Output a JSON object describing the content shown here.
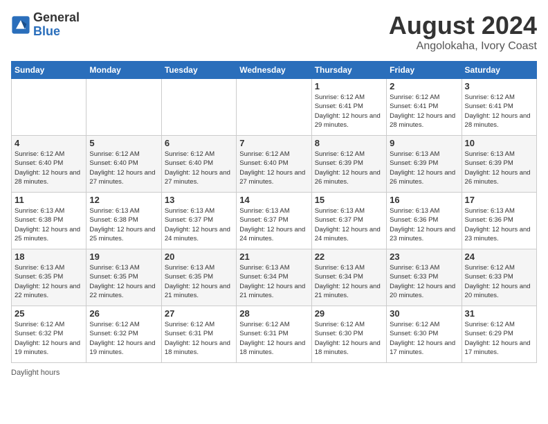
{
  "header": {
    "logo_general": "General",
    "logo_blue": "Blue",
    "month_year": "August 2024",
    "location": "Angolokaha, Ivory Coast"
  },
  "days_of_week": [
    "Sunday",
    "Monday",
    "Tuesday",
    "Wednesday",
    "Thursday",
    "Friday",
    "Saturday"
  ],
  "weeks": [
    [
      {
        "day": "",
        "info": ""
      },
      {
        "day": "",
        "info": ""
      },
      {
        "day": "",
        "info": ""
      },
      {
        "day": "",
        "info": ""
      },
      {
        "day": "1",
        "sunrise": "6:12 AM",
        "sunset": "6:41 PM",
        "daylight": "12 hours and 29 minutes."
      },
      {
        "day": "2",
        "sunrise": "6:12 AM",
        "sunset": "6:41 PM",
        "daylight": "12 hours and 28 minutes."
      },
      {
        "day": "3",
        "sunrise": "6:12 AM",
        "sunset": "6:41 PM",
        "daylight": "12 hours and 28 minutes."
      }
    ],
    [
      {
        "day": "4",
        "sunrise": "6:12 AM",
        "sunset": "6:40 PM",
        "daylight": "12 hours and 28 minutes."
      },
      {
        "day": "5",
        "sunrise": "6:12 AM",
        "sunset": "6:40 PM",
        "daylight": "12 hours and 27 minutes."
      },
      {
        "day": "6",
        "sunrise": "6:12 AM",
        "sunset": "6:40 PM",
        "daylight": "12 hours and 27 minutes."
      },
      {
        "day": "7",
        "sunrise": "6:12 AM",
        "sunset": "6:40 PM",
        "daylight": "12 hours and 27 minutes."
      },
      {
        "day": "8",
        "sunrise": "6:12 AM",
        "sunset": "6:39 PM",
        "daylight": "12 hours and 26 minutes."
      },
      {
        "day": "9",
        "sunrise": "6:13 AM",
        "sunset": "6:39 PM",
        "daylight": "12 hours and 26 minutes."
      },
      {
        "day": "10",
        "sunrise": "6:13 AM",
        "sunset": "6:39 PM",
        "daylight": "12 hours and 26 minutes."
      }
    ],
    [
      {
        "day": "11",
        "sunrise": "6:13 AM",
        "sunset": "6:38 PM",
        "daylight": "12 hours and 25 minutes."
      },
      {
        "day": "12",
        "sunrise": "6:13 AM",
        "sunset": "6:38 PM",
        "daylight": "12 hours and 25 minutes."
      },
      {
        "day": "13",
        "sunrise": "6:13 AM",
        "sunset": "6:37 PM",
        "daylight": "12 hours and 24 minutes."
      },
      {
        "day": "14",
        "sunrise": "6:13 AM",
        "sunset": "6:37 PM",
        "daylight": "12 hours and 24 minutes."
      },
      {
        "day": "15",
        "sunrise": "6:13 AM",
        "sunset": "6:37 PM",
        "daylight": "12 hours and 24 minutes."
      },
      {
        "day": "16",
        "sunrise": "6:13 AM",
        "sunset": "6:36 PM",
        "daylight": "12 hours and 23 minutes."
      },
      {
        "day": "17",
        "sunrise": "6:13 AM",
        "sunset": "6:36 PM",
        "daylight": "12 hours and 23 minutes."
      }
    ],
    [
      {
        "day": "18",
        "sunrise": "6:13 AM",
        "sunset": "6:35 PM",
        "daylight": "12 hours and 22 minutes."
      },
      {
        "day": "19",
        "sunrise": "6:13 AM",
        "sunset": "6:35 PM",
        "daylight": "12 hours and 22 minutes."
      },
      {
        "day": "20",
        "sunrise": "6:13 AM",
        "sunset": "6:35 PM",
        "daylight": "12 hours and 21 minutes."
      },
      {
        "day": "21",
        "sunrise": "6:13 AM",
        "sunset": "6:34 PM",
        "daylight": "12 hours and 21 minutes."
      },
      {
        "day": "22",
        "sunrise": "6:13 AM",
        "sunset": "6:34 PM",
        "daylight": "12 hours and 21 minutes."
      },
      {
        "day": "23",
        "sunrise": "6:13 AM",
        "sunset": "6:33 PM",
        "daylight": "12 hours and 20 minutes."
      },
      {
        "day": "24",
        "sunrise": "6:12 AM",
        "sunset": "6:33 PM",
        "daylight": "12 hours and 20 minutes."
      }
    ],
    [
      {
        "day": "25",
        "sunrise": "6:12 AM",
        "sunset": "6:32 PM",
        "daylight": "12 hours and 19 minutes."
      },
      {
        "day": "26",
        "sunrise": "6:12 AM",
        "sunset": "6:32 PM",
        "daylight": "12 hours and 19 minutes."
      },
      {
        "day": "27",
        "sunrise": "6:12 AM",
        "sunset": "6:31 PM",
        "daylight": "12 hours and 18 minutes."
      },
      {
        "day": "28",
        "sunrise": "6:12 AM",
        "sunset": "6:31 PM",
        "daylight": "12 hours and 18 minutes."
      },
      {
        "day": "29",
        "sunrise": "6:12 AM",
        "sunset": "6:30 PM",
        "daylight": "12 hours and 18 minutes."
      },
      {
        "day": "30",
        "sunrise": "6:12 AM",
        "sunset": "6:30 PM",
        "daylight": "12 hours and 17 minutes."
      },
      {
        "day": "31",
        "sunrise": "6:12 AM",
        "sunset": "6:29 PM",
        "daylight": "12 hours and 17 minutes."
      }
    ]
  ],
  "legend": {
    "daylight_hours": "Daylight hours"
  }
}
